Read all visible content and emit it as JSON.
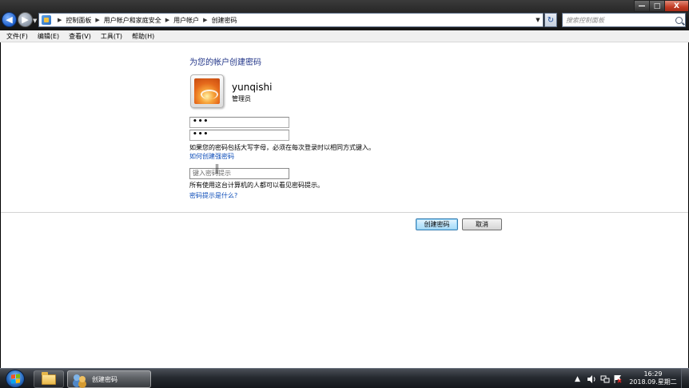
{
  "addressbar": {
    "crumbs": [
      "控制面板",
      "用户帐户和家庭安全",
      "用户帐户",
      "创建密码"
    ]
  },
  "search": {
    "placeholder": "搜索控制面板"
  },
  "window_controls": {
    "minimize": "—",
    "maximize": "□",
    "close": "X"
  },
  "menu": [
    "文件(F)",
    "编辑(E)",
    "查看(V)",
    "工具(T)",
    "帮助(H)"
  ],
  "page": {
    "title": "为您的帐户创建密码",
    "username": "yunqishi",
    "account_type": "管理员",
    "password_value": "•••",
    "confirm_value": "•••",
    "case_note": "如果您的密码包括大写字母，必须在每次登录时以相同方式键入。",
    "strong_password_link": "如何创建强密码",
    "hint_placeholder": "键入密码提示",
    "hint_note": "所有使用这台计算机的人都可以看见密码提示。",
    "hint_link": "密码提示是什么?",
    "create_button": "创建密码",
    "cancel_button": "取消"
  },
  "taskbar": {
    "active_task": "创建密码",
    "tray_arrow": "▲",
    "time": "16:29",
    "date": "2018.09.星期二"
  },
  "colors": {
    "title_blue": "#1e3287",
    "link_blue": "#0a4bb8"
  }
}
